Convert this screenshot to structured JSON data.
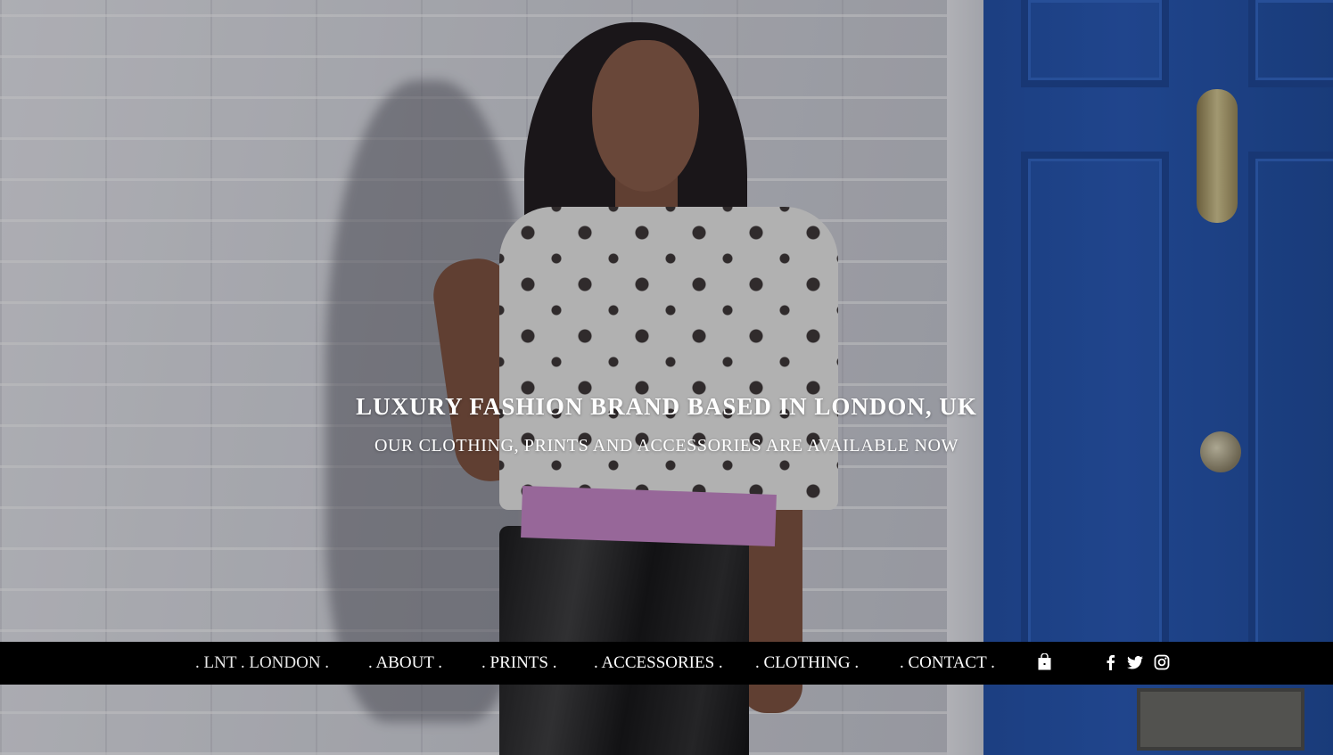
{
  "hero": {
    "headline": "LUXURY FASHION BRAND BASED IN LONDON, UK",
    "subline": "OUR CLOTHING, PRINTS AND ACCESSORIES ARE AVAILABLE NOW"
  },
  "nav": {
    "items": [
      {
        "label": ". LNT . LONDON ."
      },
      {
        "label": ". ABOUT ."
      },
      {
        "label": ". PRINTS ."
      },
      {
        "label": ". ACCESSORIES ."
      },
      {
        "label": ". CLOTHING ."
      },
      {
        "label": ". CONTACT ."
      }
    ],
    "cart_icon": "shopping-bag-icon",
    "social": [
      "facebook-icon",
      "twitter-icon",
      "instagram-icon"
    ]
  },
  "colors": {
    "nav_background": "#000000",
    "nav_text": "#ffffff",
    "door_blue": "#2458b8"
  }
}
